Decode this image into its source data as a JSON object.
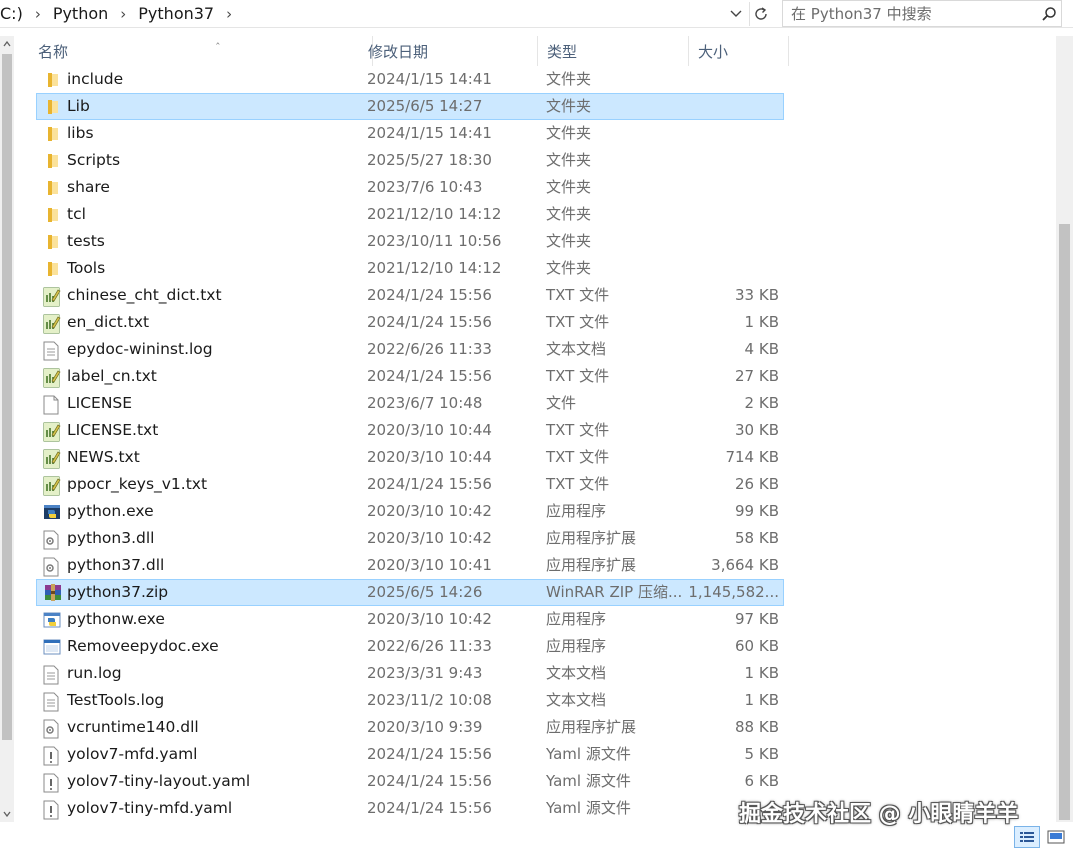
{
  "address": {
    "breadcrumbs": [
      "C:)",
      "Python",
      "Python37"
    ],
    "search_placeholder": "在 Python37 中搜索"
  },
  "columns": {
    "name": "名称",
    "date": "修改日期",
    "type": "类型",
    "size": "大小"
  },
  "files": [
    {
      "name": "include",
      "date": "2024/1/15 14:41",
      "type": "文件夹",
      "size": "",
      "icon": "folder-icon",
      "selected": false
    },
    {
      "name": "Lib",
      "date": "2025/6/5 14:27",
      "type": "文件夹",
      "size": "",
      "icon": "folder-icon",
      "selected": true
    },
    {
      "name": "libs",
      "date": "2024/1/15 14:41",
      "type": "文件夹",
      "size": "",
      "icon": "folder-icon",
      "selected": false
    },
    {
      "name": "Scripts",
      "date": "2025/5/27 18:30",
      "type": "文件夹",
      "size": "",
      "icon": "folder-icon",
      "selected": false
    },
    {
      "name": "share",
      "date": "2023/7/6 10:43",
      "type": "文件夹",
      "size": "",
      "icon": "folder-icon",
      "selected": false
    },
    {
      "name": "tcl",
      "date": "2021/12/10 14:12",
      "type": "文件夹",
      "size": "",
      "icon": "folder-icon",
      "selected": false
    },
    {
      "name": "tests",
      "date": "2023/10/11 10:56",
      "type": "文件夹",
      "size": "",
      "icon": "folder-icon",
      "selected": false
    },
    {
      "name": "Tools",
      "date": "2021/12/10 14:12",
      "type": "文件夹",
      "size": "",
      "icon": "folder-icon",
      "selected": false
    },
    {
      "name": "chinese_cht_dict.txt",
      "date": "2024/1/24 15:56",
      "type": "TXT 文件",
      "size": "33 KB",
      "icon": "txt-file-icon",
      "selected": false
    },
    {
      "name": "en_dict.txt",
      "date": "2024/1/24 15:56",
      "type": "TXT 文件",
      "size": "1 KB",
      "icon": "txt-file-icon",
      "selected": false
    },
    {
      "name": "epydoc-wininst.log",
      "date": "2022/6/26 11:33",
      "type": "文本文档",
      "size": "4 KB",
      "icon": "text-document-icon",
      "selected": false
    },
    {
      "name": "label_cn.txt",
      "date": "2024/1/24 15:56",
      "type": "TXT 文件",
      "size": "27 KB",
      "icon": "txt-file-icon",
      "selected": false
    },
    {
      "name": "LICENSE",
      "date": "2023/6/7 10:48",
      "type": "文件",
      "size": "2 KB",
      "icon": "blank-file-icon",
      "selected": false
    },
    {
      "name": "LICENSE.txt",
      "date": "2020/3/10 10:44",
      "type": "TXT 文件",
      "size": "30 KB",
      "icon": "txt-file-icon",
      "selected": false
    },
    {
      "name": "NEWS.txt",
      "date": "2020/3/10 10:44",
      "type": "TXT 文件",
      "size": "714 KB",
      "icon": "txt-file-icon",
      "selected": false
    },
    {
      "name": "ppocr_keys_v1.txt",
      "date": "2024/1/24 15:56",
      "type": "TXT 文件",
      "size": "26 KB",
      "icon": "txt-file-icon",
      "selected": false
    },
    {
      "name": "python.exe",
      "date": "2020/3/10 10:42",
      "type": "应用程序",
      "size": "99 KB",
      "icon": "python-exe-icon",
      "selected": false
    },
    {
      "name": "python3.dll",
      "date": "2020/3/10 10:42",
      "type": "应用程序扩展",
      "size": "58 KB",
      "icon": "dll-file-icon",
      "selected": false
    },
    {
      "name": "python37.dll",
      "date": "2020/3/10 10:41",
      "type": "应用程序扩展",
      "size": "3,664 KB",
      "icon": "dll-file-icon",
      "selected": false
    },
    {
      "name": "python37.zip",
      "date": "2025/6/5 14:26",
      "type": "WinRAR ZIP 压缩...",
      "size": "1,145,582...",
      "icon": "winrar-zip-icon",
      "selected": true
    },
    {
      "name": "pythonw.exe",
      "date": "2020/3/10 10:42",
      "type": "应用程序",
      "size": "97 KB",
      "icon": "pythonw-exe-icon",
      "selected": false
    },
    {
      "name": "Removeepydoc.exe",
      "date": "2022/6/26 11:33",
      "type": "应用程序",
      "size": "60 KB",
      "icon": "app-exe-icon",
      "selected": false
    },
    {
      "name": "run.log",
      "date": "2023/3/31 9:43",
      "type": "文本文档",
      "size": "1 KB",
      "icon": "text-document-icon",
      "selected": false
    },
    {
      "name": "TestTools.log",
      "date": "2023/11/2 10:08",
      "type": "文本文档",
      "size": "1 KB",
      "icon": "text-document-icon",
      "selected": false
    },
    {
      "name": "vcruntime140.dll",
      "date": "2020/3/10 9:39",
      "type": "应用程序扩展",
      "size": "88 KB",
      "icon": "dll-file-icon",
      "selected": false
    },
    {
      "name": "yolov7-mfd.yaml",
      "date": "2024/1/24 15:56",
      "type": "Yaml 源文件",
      "size": "5 KB",
      "icon": "yaml-file-icon",
      "selected": false
    },
    {
      "name": "yolov7-tiny-layout.yaml",
      "date": "2024/1/24 15:56",
      "type": "Yaml 源文件",
      "size": "6 KB",
      "icon": "yaml-file-icon",
      "selected": false
    },
    {
      "name": "yolov7-tiny-mfd.yaml",
      "date": "2024/1/24 15:56",
      "type": "Yaml 源文件",
      "size": "",
      "icon": "yaml-file-icon",
      "selected": false
    }
  ],
  "watermark": "掘金技术社区 @ 小眼睛羊羊",
  "colors": {
    "selection_bg": "#cce8ff",
    "selection_border": "#99d1ff",
    "header_text": "#4c607a",
    "folder": "#f4c542"
  }
}
